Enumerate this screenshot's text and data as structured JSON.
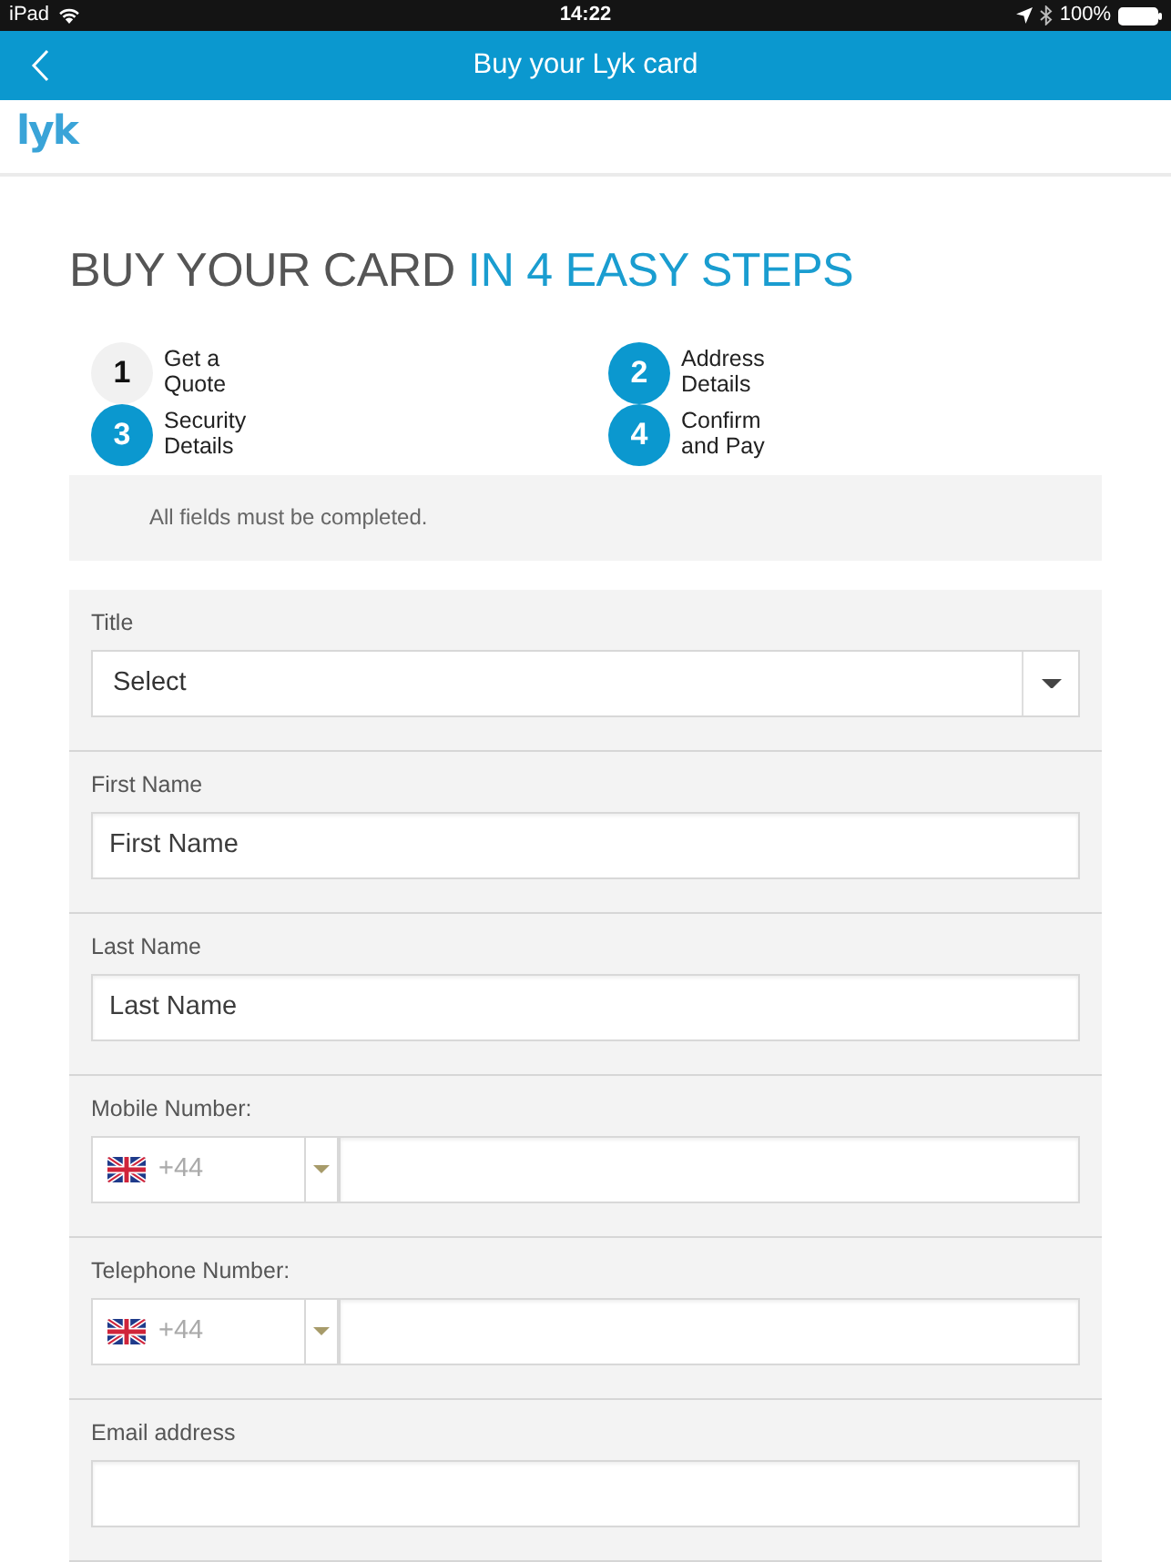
{
  "status_bar": {
    "device": "iPad",
    "time": "14:22",
    "battery": "100%"
  },
  "nav_bar": {
    "title": "Buy your Lyk card"
  },
  "logo": {
    "text": "lyk"
  },
  "heading": {
    "text": "BUY YOUR CARD",
    "highlight": "IN 4 EASY STEPS"
  },
  "steps": [
    {
      "number": "1",
      "label": "Get a Quote",
      "completed": true
    },
    {
      "number": "2",
      "label": "Address Details",
      "completed": false
    },
    {
      "number": "3",
      "label": "Security Details",
      "completed": false
    },
    {
      "number": "4",
      "label": "Confirm and Pay",
      "completed": false
    }
  ],
  "notice": "All fields must be completed.",
  "form": {
    "fields": [
      {
        "kind": "select",
        "label": "Title",
        "value": "Select"
      },
      {
        "kind": "text",
        "label": "First Name",
        "placeholder": "First Name"
      },
      {
        "kind": "text",
        "label": "Last Name",
        "placeholder": "Last Name"
      },
      {
        "kind": "phone",
        "label": "Mobile Number:",
        "dial_code": "+44"
      },
      {
        "kind": "phone",
        "label": "Telephone Number:",
        "dial_code": "+44"
      },
      {
        "kind": "email",
        "label": "Email address"
      }
    ]
  }
}
